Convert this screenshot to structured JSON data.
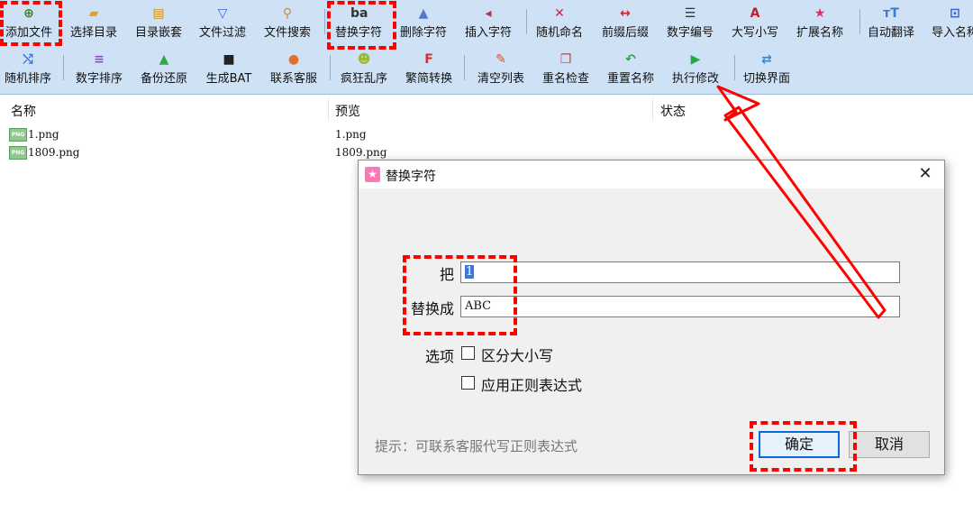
{
  "toolbar": {
    "row1": [
      {
        "label": "添加文件",
        "icon": "add-file-icon",
        "glyph": "⊕",
        "color": "#3a7a3a"
      },
      {
        "label": "选择目录",
        "icon": "folder-icon",
        "glyph": "▰",
        "color": "#e0a020"
      },
      {
        "label": "目录嵌套",
        "icon": "nested-folder-icon",
        "glyph": "▤",
        "color": "#d09020"
      },
      {
        "label": "文件过滤",
        "icon": "filter-icon",
        "glyph": "▽",
        "color": "#4466cc"
      },
      {
        "label": "文件搜索",
        "icon": "search-icon",
        "glyph": "⚲",
        "color": "#c89030"
      },
      {
        "label": "替换字符",
        "icon": "replace-chars-icon",
        "glyph": "ba",
        "color": "#333333"
      },
      {
        "label": "删除字符",
        "icon": "delete-chars-icon",
        "glyph": "▲",
        "color": "#5577cc"
      },
      {
        "label": "插入字符",
        "icon": "insert-chars-icon",
        "glyph": "◂",
        "color": "#c03040"
      },
      {
        "label": "随机命名",
        "icon": "shuffle-icon",
        "glyph": "✕",
        "color": "#d02050"
      },
      {
        "label": "前缀后缀",
        "icon": "prefix-suffix-icon",
        "glyph": "↔",
        "color": "#d02030"
      },
      {
        "label": "数字编号",
        "icon": "numbered-list-icon",
        "glyph": "☰",
        "color": "#333333"
      },
      {
        "label": "大写小写",
        "icon": "case-icon",
        "glyph": "A",
        "color": "#c02030"
      },
      {
        "label": "扩展名称",
        "icon": "star-icon",
        "glyph": "★",
        "color": "#e03060"
      },
      {
        "label": "自动翻译",
        "icon": "translate-icon",
        "glyph": "тT",
        "color": "#3b7bd0"
      },
      {
        "label": "导入名称",
        "icon": "import-icon",
        "glyph": "⊡",
        "color": "#3b5bd0"
      }
    ],
    "row2": [
      {
        "label": "随机排序",
        "icon": "random-sort-icon",
        "glyph": "⤭",
        "color": "#3b6fd0"
      },
      {
        "label": "数字排序",
        "icon": "list-sort-icon",
        "glyph": "≡",
        "color": "#8a4fc8"
      },
      {
        "label": "备份还原",
        "icon": "drive-icon",
        "glyph": "▲",
        "color": "#2aa84a"
      },
      {
        "label": "生成BAT",
        "icon": "terminal-icon",
        "glyph": "■",
        "color": "#222222"
      },
      {
        "label": "联系客服",
        "icon": "support-icon",
        "glyph": "●",
        "color": "#e07030"
      },
      {
        "label": "疯狂乱序",
        "icon": "crazy-icon",
        "glyph": "☻",
        "color": "#9ab830"
      },
      {
        "label": "繁简转换",
        "icon": "f-icon",
        "glyph": "F",
        "color": "#d03030"
      },
      {
        "label": "清空列表",
        "icon": "clear-icon",
        "glyph": "✎",
        "color": "#d05030"
      },
      {
        "label": "重名检查",
        "icon": "duplicate-check-icon",
        "glyph": "❐",
        "color": "#c04040"
      },
      {
        "label": "重置名称",
        "icon": "undo-icon",
        "glyph": "↶",
        "color": "#2aa84a"
      },
      {
        "label": "执行修改",
        "icon": "play-icon",
        "glyph": "▶",
        "color": "#22aa44"
      },
      {
        "label": "切换界面",
        "icon": "switch-icon",
        "glyph": "⇄",
        "color": "#2a8ad8"
      }
    ]
  },
  "list": {
    "columns": [
      "名称",
      "预览",
      "状态"
    ],
    "rows": [
      {
        "name": "1.png",
        "preview": "1.png"
      },
      {
        "name": "1809.png",
        "preview": "1809.png"
      }
    ],
    "file_badge": "PNG"
  },
  "dialog": {
    "title": "替换字符",
    "title_icon": "★",
    "close_glyph": "✕",
    "find_label": "把",
    "find_value": "1",
    "replace_label": "替换成",
    "replace_value": "ABC",
    "options_label": "选项",
    "option_case": "区分大小写",
    "option_regex": "应用正则表达式",
    "hint": "提示：可联系客服代写正则表达式",
    "ok_label": "确定",
    "cancel_label": "取消"
  },
  "colors": {
    "toolbar_bg": "#cfe2f5",
    "annotation_red": "#ff0000",
    "ok_border": "#0a68d8"
  }
}
